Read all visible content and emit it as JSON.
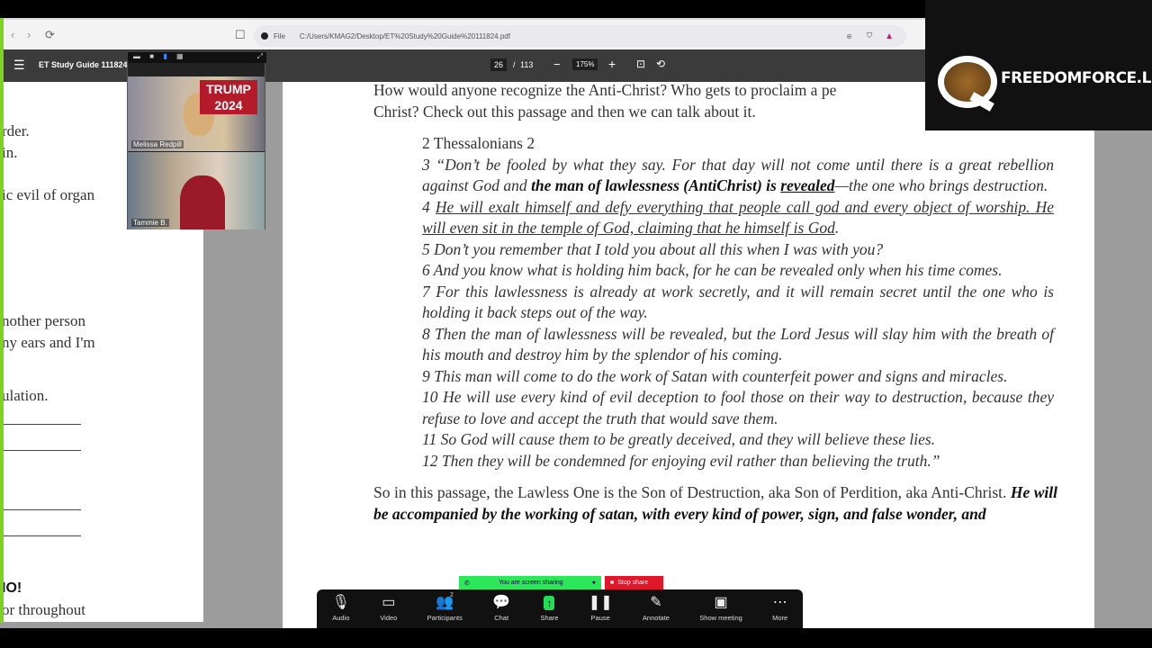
{
  "browser": {
    "back": "‹",
    "forward": "›",
    "reload": "⟳",
    "bookmark": "☐",
    "scheme": "File",
    "url": "C:/Users/KMAG2/Desktop/ET%20Study%20Guide%20111824.pdf"
  },
  "pdf_toolbar": {
    "title": "ET Study Guide 111824",
    "page_current": "26",
    "page_sep": "/",
    "page_total": "113",
    "zoom_out": "−",
    "zoom": "175%",
    "zoom_in": "+"
  },
  "logo": {
    "text": "FREEDOMFORCE.LIVE"
  },
  "video": {
    "participants": [
      {
        "name": "Melissa Redpill"
      },
      {
        "name": "Tammie B."
      }
    ],
    "sign_text": "TRUMP 2024"
  },
  "left_page": {
    "lines": [
      "rder.",
      "in.",
      "ic evil of organ",
      "nother person",
      "ny ears and I'm",
      "ulation.",
      "IO!",
      "or throughout"
    ]
  },
  "main_page": {
    "intro": "How would anyone recognize the Anti-Christ? Who gets to proclaim a pe",
    "intro2": "Christ? Check out this passage and then we can talk about it.",
    "ref": "2 Thessalonians 2",
    "v3a": "3 “Don’t be fooled by what they say. For that day will not come until there is a great rebellion against God and ",
    "v3b": "the man of lawlessness (AntiChrist) is ",
    "v3c": "revealed",
    "v3d": "—the one who brings destruction.",
    "v4num": "4 ",
    "v4": "He will exalt himself and defy everything that people call god and every object of worship. He will even sit in the temple of God, claiming that he himself is God",
    "v4end": ".",
    "v5": "5 Don’t you remember that I told you about all this when I was with you?",
    "v6": "6 And you know what is holding him back, for he can be revealed only when his time comes.",
    "v7": "7 For this lawlessness is already at work secretly, and it will remain secret until the one who is holding it back steps out of the way.",
    "v8": "8 Then the man of lawlessness will be revealed, but the Lord Jesus will slay him with the breath of his mouth and destroy him by the splendor of his coming.",
    "v9": "9 This man will come to do the work of Satan with counterfeit power and signs and miracles.",
    "v10": "10 He will use every kind of evil deception to fool those on their way to destruction, because they refuse to love and accept the truth that would save them.",
    "v11": "11 So God will cause them to be greatly deceived, and they will believe these lies.",
    "v12": "12 Then they will be condemned for enjoying evil rather than believing the truth.”",
    "outro": "So in this passage, the Lawless One is the Son of Destruction, aka Son of Perdition, aka Anti-Christ. ",
    "outro_bold": "He will be accompanied by the working of satan, with every kind of power, sign, and false wonder, and"
  },
  "share": {
    "banner": "You are screen sharing",
    "stop": "Stop share"
  },
  "zoom_toolbar": {
    "items": [
      {
        "label": "Audio",
        "icon": "microphone-icon"
      },
      {
        "label": "Video",
        "icon": "camera-icon"
      },
      {
        "label": "Participants",
        "icon": "participants-icon",
        "count": "2"
      },
      {
        "label": "Chat",
        "icon": "chat-icon"
      },
      {
        "label": "Share",
        "icon": "share-icon"
      },
      {
        "label": "Pause",
        "icon": "pause-icon"
      },
      {
        "label": "Annotate",
        "icon": "pencil-icon"
      },
      {
        "label": "Show meeting",
        "icon": "meeting-icon"
      },
      {
        "label": "More",
        "icon": "more-icon"
      }
    ]
  },
  "colors": {
    "share_green": "#2ee65a",
    "stop_red": "#e0162b",
    "stripe_green": "#7ed321"
  }
}
